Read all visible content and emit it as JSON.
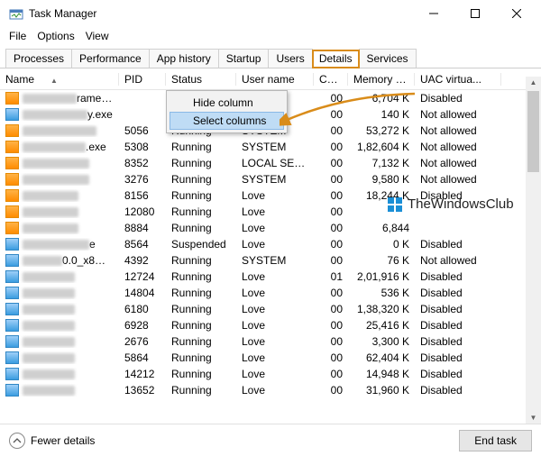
{
  "window": {
    "title": "Task Manager"
  },
  "menus": {
    "file": "File",
    "options": "Options",
    "view": "View"
  },
  "tabs": {
    "processes": "Processes",
    "performance": "Performance",
    "apphistory": "App history",
    "startup": "Startup",
    "users": "Users",
    "details": "Details",
    "services": "Services"
  },
  "columns": {
    "name": "Name",
    "pid": "PID",
    "status": "Status",
    "user": "User name",
    "cpu": "CPU",
    "memory": "Memory (a...",
    "uac": "UAC virtua..."
  },
  "context_menu": {
    "hide": "Hide column",
    "select": "Select columns"
  },
  "rows": [
    {
      "icon": "o",
      "name_suffix": "rame…",
      "name_blur_w": 60,
      "pid": "",
      "status": "",
      "user": "",
      "cpu": "00",
      "mem": "6,704 K",
      "uac": "Disabled"
    },
    {
      "icon": "b",
      "name_suffix": "y.exe",
      "name_blur_w": 72,
      "pid": "",
      "status": "",
      "user": "",
      "cpu": "00",
      "mem": "140 K",
      "uac": "Not allowed"
    },
    {
      "icon": "o",
      "name_suffix": "",
      "name_blur_w": 82,
      "pid": "5056",
      "status": "Running",
      "user": "SYSTEM",
      "cpu": "00",
      "mem": "53,272 K",
      "uac": "Not allowed"
    },
    {
      "icon": "o",
      "name_suffix": ".exe",
      "name_blur_w": 70,
      "pid": "5308",
      "status": "Running",
      "user": "SYSTEM",
      "cpu": "00",
      "mem": "1,82,604 K",
      "uac": "Not allowed"
    },
    {
      "icon": "o",
      "name_suffix": "",
      "name_blur_w": 74,
      "pid": "8352",
      "status": "Running",
      "user": "LOCAL SE…",
      "cpu": "00",
      "mem": "7,132 K",
      "uac": "Not allowed"
    },
    {
      "icon": "o",
      "name_suffix": "",
      "name_blur_w": 74,
      "pid": "3276",
      "status": "Running",
      "user": "SYSTEM",
      "cpu": "00",
      "mem": "9,580 K",
      "uac": "Not allowed"
    },
    {
      "icon": "o",
      "name_suffix": "",
      "name_blur_w": 62,
      "pid": "8156",
      "status": "Running",
      "user": "Love",
      "cpu": "00",
      "mem": "18,244 K",
      "uac": "Disabled"
    },
    {
      "icon": "o",
      "name_suffix": "",
      "name_blur_w": 62,
      "pid": "12080",
      "status": "Running",
      "user": "Love",
      "cpu": "00",
      "mem": "",
      "uac": ""
    },
    {
      "icon": "o",
      "name_suffix": "",
      "name_blur_w": 62,
      "pid": "8884",
      "status": "Running",
      "user": "Love",
      "cpu": "00",
      "mem": "6,844",
      "uac": ""
    },
    {
      "icon": "b",
      "name_suffix": "e",
      "name_blur_w": 74,
      "pid": "8564",
      "status": "Suspended",
      "user": "Love",
      "cpu": "00",
      "mem": "0 K",
      "uac": "Disabled"
    },
    {
      "icon": "b",
      "name_suffix": "0.0_x8…",
      "name_blur_w": 44,
      "pid": "4392",
      "status": "Running",
      "user": "SYSTEM",
      "cpu": "00",
      "mem": "76 K",
      "uac": "Not allowed"
    },
    {
      "icon": "b",
      "name_suffix": "",
      "name_blur_w": 58,
      "pid": "12724",
      "status": "Running",
      "user": "Love",
      "cpu": "01",
      "mem": "2,01,916 K",
      "uac": "Disabled"
    },
    {
      "icon": "b",
      "name_suffix": "",
      "name_blur_w": 58,
      "pid": "14804",
      "status": "Running",
      "user": "Love",
      "cpu": "00",
      "mem": "536 K",
      "uac": "Disabled"
    },
    {
      "icon": "b",
      "name_suffix": "",
      "name_blur_w": 58,
      "pid": "6180",
      "status": "Running",
      "user": "Love",
      "cpu": "00",
      "mem": "1,38,320 K",
      "uac": "Disabled"
    },
    {
      "icon": "b",
      "name_suffix": "",
      "name_blur_w": 58,
      "pid": "6928",
      "status": "Running",
      "user": "Love",
      "cpu": "00",
      "mem": "25,416 K",
      "uac": "Disabled"
    },
    {
      "icon": "b",
      "name_suffix": "",
      "name_blur_w": 58,
      "pid": "2676",
      "status": "Running",
      "user": "Love",
      "cpu": "00",
      "mem": "3,300 K",
      "uac": "Disabled"
    },
    {
      "icon": "b",
      "name_suffix": "",
      "name_blur_w": 58,
      "pid": "5864",
      "status": "Running",
      "user": "Love",
      "cpu": "00",
      "mem": "62,404 K",
      "uac": "Disabled"
    },
    {
      "icon": "b",
      "name_suffix": "",
      "name_blur_w": 58,
      "pid": "14212",
      "status": "Running",
      "user": "Love",
      "cpu": "00",
      "mem": "14,948 K",
      "uac": "Disabled"
    },
    {
      "icon": "b",
      "name_suffix": "",
      "name_blur_w": 58,
      "pid": "13652",
      "status": "Running",
      "user": "Love",
      "cpu": "00",
      "mem": "31,960 K",
      "uac": "Disabled"
    }
  ],
  "footer": {
    "fewer": "Fewer details",
    "endtask": "End task"
  },
  "watermark": {
    "text": "TheWindowsClub"
  }
}
